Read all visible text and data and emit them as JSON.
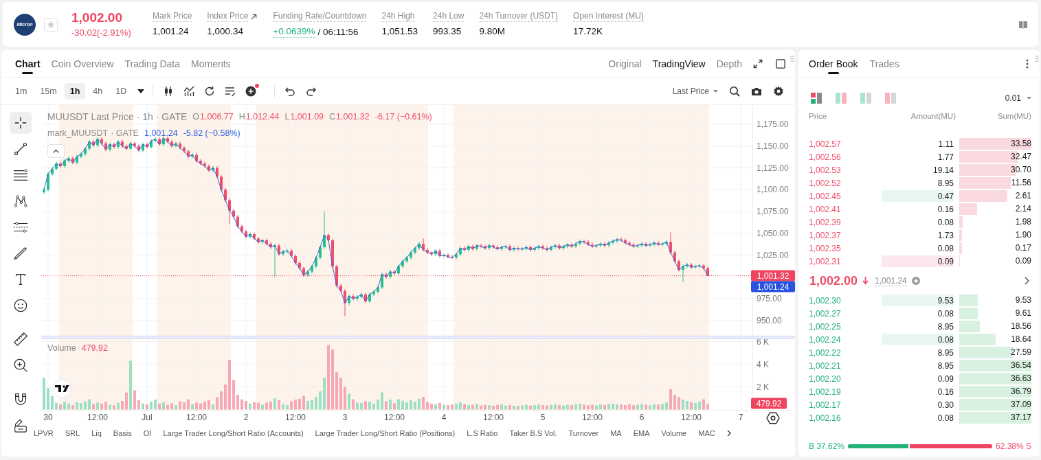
{
  "header": {
    "logo_text": "Micron",
    "starred": false,
    "price": "1,002.00",
    "change": "-30.02(-2.91%)",
    "stats": [
      {
        "kind": "plain",
        "label": "Mark Price",
        "value": "1,001.24"
      },
      {
        "kind": "link",
        "label": "Index Price",
        "value": "1,000.34"
      },
      {
        "kind": "funding",
        "label": "Funding Rate/Countdown",
        "value": "+0.0639%",
        "countdown": "/ 06:11:56"
      },
      {
        "kind": "plain",
        "label": "24h High",
        "value": "1,051.53"
      },
      {
        "kind": "plain",
        "label": "24h Low",
        "value": "993.35"
      },
      {
        "kind": "plain",
        "label": "24h Turnover (USDT)",
        "value": "9.80M"
      },
      {
        "kind": "plain",
        "label": "Open Interest (MU)",
        "value": "17.72K"
      }
    ]
  },
  "chart_panel": {
    "tabs": [
      {
        "label": "Chart",
        "selected": true
      },
      {
        "label": "Coin Overview",
        "selected": false
      },
      {
        "label": "Trading Data",
        "selected": false
      },
      {
        "label": "Moments",
        "selected": false
      }
    ],
    "views": [
      {
        "label": "Original",
        "selected": false
      },
      {
        "label": "TradingView",
        "selected": true
      },
      {
        "label": "Depth",
        "selected": false
      }
    ],
    "intervals": [
      {
        "label": "1m",
        "selected": false
      },
      {
        "label": "15m",
        "selected": false
      },
      {
        "label": "1h",
        "selected": true
      },
      {
        "label": "4h",
        "selected": false
      },
      {
        "label": "1D",
        "selected": false
      }
    ],
    "toolbar_alert": true,
    "price_source": "Last Price",
    "drawing_tools": [
      {
        "selected": true
      },
      {
        "selected": false
      },
      {
        "selected": false
      },
      {
        "selected": false
      },
      {
        "selected": false
      },
      {
        "selected": false
      },
      {
        "selected": false
      },
      {
        "selected": false
      },
      {
        "selected": false
      },
      {
        "selected": false
      },
      {
        "selected": false
      },
      {
        "selected": false
      }
    ],
    "legend": {
      "title": "MUUSDT Last Price · 1h · GATE",
      "ohlc": [
        {
          "key": "O",
          "value": "1,006.77"
        },
        {
          "key": "H",
          "value": "1,012.44"
        },
        {
          "key": "L",
          "value": "1,001.09"
        },
        {
          "key": "C",
          "value": "1,001.32"
        }
      ],
      "change": "-6.17 (−0.61%)"
    },
    "mark_legend": {
      "source": "· GATE",
      "value": "1,001.24",
      "change": "-5.82 (−0.58%)"
    },
    "chart_data": {
      "type": "candlestick",
      "grid": true,
      "ylim": [
        932.5,
        1197.05
      ],
      "yticks": [
        {
          "value": 1175,
          "label": "1,175.00"
        },
        {
          "value": 1150,
          "label": "1,150.00"
        },
        {
          "value": 1125,
          "label": "1,125.00"
        },
        {
          "value": 1100,
          "label": "1,100.00"
        },
        {
          "value": 1075,
          "label": "1,075.00"
        },
        {
          "value": 1050,
          "label": "1,050.00"
        },
        {
          "value": 1025,
          "label": "1,025.00"
        },
        {
          "value": 975,
          "label": "975.00"
        },
        {
          "value": 950,
          "label": "950.00"
        }
      ],
      "categories": [
        null,
        null,
        null,
        null,
        null,
        null,
        null,
        null,
        null,
        null,
        null,
        null,
        null,
        null,
        null,
        null,
        null,
        null,
        null,
        null,
        null,
        null,
        null,
        null,
        null,
        null,
        null,
        null,
        null,
        null,
        null,
        null,
        null,
        null,
        null,
        null,
        null,
        null,
        null,
        null,
        null,
        null,
        null,
        null,
        null,
        null,
        null,
        null,
        null,
        null,
        null,
        null,
        null,
        null,
        null,
        null,
        null,
        null,
        null,
        null,
        null,
        null,
        null,
        null,
        null,
        null,
        null,
        null,
        null,
        null,
        null,
        null,
        null,
        null,
        null,
        null,
        null,
        null,
        null,
        null,
        null,
        null,
        null,
        null,
        null,
        null,
        null,
        null,
        null,
        null,
        null,
        null,
        null,
        null,
        null,
        null,
        null,
        null,
        null,
        null,
        null,
        null,
        null,
        null,
        null,
        null,
        null,
        null,
        null,
        null,
        null,
        null,
        null,
        null,
        null,
        null,
        null,
        null,
        null,
        null,
        null,
        null,
        null,
        null,
        null,
        null,
        null,
        null,
        null,
        null,
        null,
        null,
        null,
        null,
        null,
        null,
        null,
        null,
        null,
        null,
        null,
        null,
        null,
        null,
        null,
        null,
        null,
        null,
        null,
        null,
        null,
        null,
        null,
        null,
        null,
        null,
        null,
        null,
        null,
        null,
        null,
        null,
        null,
        null,
        null,
        null,
        null,
        null,
        null,
        null,
        null
      ],
      "ohlc": [
        [
          1097,
          1102,
          1095,
          1100
        ],
        [
          1100,
          1120,
          1098,
          1118
        ],
        [
          1118,
          1126,
          1116,
          1124
        ],
        [
          1124,
          1132,
          1122,
          1130
        ],
        [
          1130,
          1132,
          1125,
          1127
        ],
        [
          1127,
          1135,
          1125,
          1133
        ],
        [
          1133,
          1138,
          1131,
          1136
        ],
        [
          1136,
          1138,
          1129,
          1131
        ],
        [
          1131,
          1140,
          1129,
          1138
        ],
        [
          1138,
          1143,
          1136,
          1141
        ],
        [
          1141,
          1149,
          1139,
          1147
        ],
        [
          1147,
          1157,
          1145,
          1155
        ],
        [
          1155,
          1157,
          1149,
          1151
        ],
        [
          1151,
          1160,
          1149,
          1158
        ],
        [
          1158,
          1160,
          1151,
          1153
        ],
        [
          1153,
          1155,
          1144,
          1146
        ],
        [
          1146,
          1154,
          1144,
          1152
        ],
        [
          1152,
          1154,
          1147,
          1149
        ],
        [
          1149,
          1157,
          1147,
          1155
        ],
        [
          1155,
          1157,
          1148,
          1150
        ],
        [
          1150,
          1152,
          1145,
          1147
        ],
        [
          1147,
          1155,
          1145,
          1153
        ],
        [
          1153,
          1155,
          1148,
          1150
        ],
        [
          1150,
          1152,
          1143,
          1145
        ],
        [
          1145,
          1154,
          1143,
          1152
        ],
        [
          1152,
          1154,
          1147,
          1149
        ],
        [
          1149,
          1158,
          1147,
          1156
        ],
        [
          1156,
          1160,
          1154,
          1158
        ],
        [
          1158,
          1160,
          1150,
          1152
        ],
        [
          1152,
          1161,
          1150,
          1159
        ],
        [
          1159,
          1161,
          1153,
          1155
        ],
        [
          1155,
          1157,
          1148,
          1150
        ],
        [
          1150,
          1155,
          1148,
          1153
        ],
        [
          1153,
          1155,
          1146,
          1148
        ],
        [
          1148,
          1150,
          1142,
          1144
        ],
        [
          1144,
          1146,
          1136,
          1138
        ],
        [
          1138,
          1142,
          1136,
          1140
        ],
        [
          1140,
          1142,
          1131,
          1133
        ],
        [
          1133,
          1135,
          1128,
          1130
        ],
        [
          1130,
          1132,
          1125,
          1127
        ],
        [
          1127,
          1129,
          1120,
          1122
        ],
        [
          1122,
          1127,
          1120,
          1125
        ],
        [
          1125,
          1127,
          1113,
          1115
        ],
        [
          1115,
          1117,
          1098,
          1100
        ],
        [
          1100,
          1102,
          1086,
          1088
        ],
        [
          1088,
          1090,
          1060,
          1076
        ],
        [
          1076,
          1078,
          1067,
          1069
        ],
        [
          1069,
          1071,
          1056,
          1058
        ],
        [
          1058,
          1060,
          1050,
          1052
        ],
        [
          1052,
          1054,
          1044,
          1046
        ],
        [
          1046,
          1051,
          1044,
          1049
        ],
        [
          1049,
          1051,
          1042,
          1044
        ],
        [
          1044,
          1046,
          1038,
          1040
        ],
        [
          1040,
          1044,
          1038,
          1042
        ],
        [
          1042,
          1044,
          1036,
          1038
        ],
        [
          1038,
          1040,
          1032,
          1034
        ],
        [
          1034,
          1038,
          1000,
          1036
        ],
        [
          1036,
          1038,
          1024,
          1026
        ],
        [
          1026,
          1031,
          1024,
          1029
        ],
        [
          1029,
          1032,
          1027,
          1030
        ],
        [
          1030,
          1032,
          1022,
          1024
        ],
        [
          1024,
          1026,
          1014,
          1016
        ],
        [
          1016,
          1018,
          1008,
          1010
        ],
        [
          1010,
          1012,
          1000,
          1002
        ],
        [
          1002,
          1008,
          1000,
          1006
        ],
        [
          1006,
          1014,
          1004,
          1012
        ],
        [
          1012,
          1024,
          1010,
          1022
        ],
        [
          1022,
          1036,
          1020,
          1034
        ],
        [
          1034,
          1075,
          1032,
          1048
        ],
        [
          1048,
          1050,
          1040,
          1042
        ],
        [
          1042,
          1044,
          1010,
          1012
        ],
        [
          1012,
          1014,
          988,
          990
        ],
        [
          990,
          992,
          982,
          984
        ],
        [
          984,
          986,
          955,
          970
        ],
        [
          970,
          980,
          968,
          978
        ],
        [
          978,
          980,
          973,
          975
        ],
        [
          975,
          979,
          973,
          977
        ],
        [
          977,
          982,
          975,
          980
        ],
        [
          980,
          982,
          970,
          972
        ],
        [
          972,
          982,
          970,
          980
        ],
        [
          980,
          985,
          978,
          983
        ],
        [
          983,
          990,
          981,
          988
        ],
        [
          988,
          1005,
          986,
          1003
        ],
        [
          1003,
          1005,
          998,
          1000
        ],
        [
          1000,
          1008,
          998,
          1006
        ],
        [
          1006,
          1008,
          1002,
          1004
        ],
        [
          1004,
          1014,
          1002,
          1012
        ],
        [
          1012,
          1020,
          1010,
          1018
        ],
        [
          1018,
          1024,
          1016,
          1022
        ],
        [
          1022,
          1030,
          1020,
          1028
        ],
        [
          1028,
          1035,
          1026,
          1033
        ],
        [
          1033,
          1040,
          1031,
          1038
        ],
        [
          1038,
          1044,
          1029,
          1031
        ],
        [
          1031,
          1033,
          1026,
          1028
        ],
        [
          1028,
          1030,
          1024,
          1026
        ],
        [
          1026,
          1032,
          1024,
          1030
        ],
        [
          1030,
          1032,
          1022,
          1024
        ],
        [
          1024,
          1027,
          1022,
          1025
        ],
        [
          1025,
          1027,
          1021,
          1023
        ],
        [
          1023,
          1025,
          1020,
          1022
        ],
        [
          1022,
          1028,
          1020,
          1026
        ],
        [
          1026,
          1035,
          1024,
          1033
        ],
        [
          1033,
          1035,
          1029,
          1031
        ],
        [
          1031,
          1037,
          1029,
          1035
        ],
        [
          1035,
          1037,
          1030,
          1032
        ],
        [
          1032,
          1038,
          1030,
          1036
        ],
        [
          1036,
          1038,
          1033,
          1035
        ],
        [
          1035,
          1037,
          1031,
          1033
        ],
        [
          1033,
          1038,
          1031,
          1036
        ],
        [
          1036,
          1038,
          1032,
          1034
        ],
        [
          1034,
          1036,
          1030,
          1032
        ],
        [
          1032,
          1036,
          1030,
          1034
        ],
        [
          1034,
          1037,
          1032,
          1035
        ],
        [
          1035,
          1037,
          1029,
          1031
        ],
        [
          1031,
          1035,
          1029,
          1033
        ],
        [
          1033,
          1035,
          1030,
          1032
        ],
        [
          1032,
          1034,
          1030,
          1032
        ],
        [
          1032,
          1036,
          1030,
          1034
        ],
        [
          1034,
          1036,
          1029,
          1031
        ],
        [
          1031,
          1035,
          1029,
          1033
        ],
        [
          1033,
          1037,
          1031,
          1035
        ],
        [
          1035,
          1037,
          1031,
          1033
        ],
        [
          1033,
          1035,
          1029,
          1031
        ],
        [
          1031,
          1036,
          1029,
          1034
        ],
        [
          1034,
          1038,
          1032,
          1036
        ],
        [
          1036,
          1038,
          1031,
          1033
        ],
        [
          1033,
          1037,
          1031,
          1035
        ],
        [
          1035,
          1039,
          1033,
          1037
        ],
        [
          1037,
          1039,
          1033,
          1035
        ],
        [
          1035,
          1040,
          1033,
          1038
        ],
        [
          1038,
          1043,
          1036,
          1041
        ],
        [
          1041,
          1043,
          1038,
          1040
        ],
        [
          1040,
          1042,
          1035,
          1037
        ],
        [
          1037,
          1039,
          1033,
          1035
        ],
        [
          1035,
          1038,
          1033,
          1036
        ],
        [
          1036,
          1040,
          1034,
          1038
        ],
        [
          1038,
          1040,
          1034,
          1036
        ],
        [
          1036,
          1041,
          1034,
          1039
        ],
        [
          1039,
          1043,
          1037,
          1041
        ],
        [
          1041,
          1045,
          1039,
          1043
        ],
        [
          1043,
          1045,
          1040,
          1042
        ],
        [
          1042,
          1044,
          1037,
          1039
        ],
        [
          1039,
          1041,
          1035,
          1037
        ],
        [
          1037,
          1039,
          1033,
          1035
        ],
        [
          1035,
          1038,
          1033,
          1036
        ],
        [
          1036,
          1040,
          1034,
          1038
        ],
        [
          1038,
          1040,
          1034,
          1036
        ],
        [
          1036,
          1039,
          1034,
          1037
        ],
        [
          1037,
          1041,
          1035,
          1039
        ],
        [
          1039,
          1041,
          1035,
          1037
        ],
        [
          1037,
          1040,
          1035,
          1038
        ],
        [
          1038,
          1042,
          1036,
          1040
        ],
        [
          1040,
          1051,
          1026,
          1028
        ],
        [
          1028,
          1030,
          1016,
          1018
        ],
        [
          1018,
          1020,
          1006,
          1008
        ],
        [
          1008,
          1014,
          994,
          1012
        ],
        [
          1012,
          1016,
          1010,
          1014
        ],
        [
          1014,
          1016,
          1009,
          1011
        ],
        [
          1011,
          1014,
          1009,
          1012
        ],
        [
          1012,
          1015,
          1010,
          1013
        ],
        [
          1013,
          1015,
          1008,
          1010
        ],
        [
          1010,
          1012,
          1001,
          1001
        ],
        null,
        null,
        null,
        null,
        null,
        null,
        null,
        null,
        null
      ],
      "series": [
        {
          "name": "mark_MUUSDT",
          "type": "line",
          "color": "#3a5fe0",
          "values": [
            1100,
            1118,
            1124,
            1130,
            1127,
            1133,
            1136,
            1131,
            1138,
            1141,
            1147,
            1155,
            1151,
            1158,
            1153,
            1146,
            1152,
            1149,
            1155,
            1150,
            1147,
            1153,
            1150,
            1145,
            1152,
            1149,
            1156,
            1158,
            1152,
            1159,
            1155,
            1150,
            1153,
            1148,
            1144,
            1138,
            1140,
            1133,
            1130,
            1127,
            1122,
            1125,
            1115,
            1100,
            1088,
            1076,
            1069,
            1058,
            1052,
            1046,
            1049,
            1044,
            1040,
            1042,
            1038,
            1034,
            1036,
            1026,
            1029,
            1030,
            1024,
            1016,
            1010,
            1002,
            1006,
            1012,
            1022,
            1034,
            1048,
            1042,
            1012,
            990,
            984,
            970,
            978,
            975,
            977,
            980,
            972,
            980,
            983,
            988,
            1003,
            1000,
            1006,
            1004,
            1012,
            1018,
            1022,
            1028,
            1033,
            1038,
            1031,
            1028,
            1026,
            1030,
            1024,
            1025,
            1023,
            1022,
            1026,
            1033,
            1031,
            1035,
            1032,
            1036,
            1035,
            1033,
            1036,
            1034,
            1032,
            1034,
            1035,
            1031,
            1033,
            1032,
            1032,
            1034,
            1031,
            1033,
            1035,
            1033,
            1031,
            1034,
            1036,
            1033,
            1035,
            1037,
            1035,
            1038,
            1041,
            1040,
            1037,
            1035,
            1036,
            1038,
            1036,
            1039,
            1041,
            1043,
            1042,
            1039,
            1037,
            1035,
            1036,
            1038,
            1036,
            1037,
            1039,
            1037,
            1038,
            1040,
            1028,
            1018,
            1008,
            1012,
            1014,
            1011,
            1012,
            1013,
            1010,
            1001,
            null,
            null,
            null,
            null,
            null,
            null,
            null,
            null,
            null
          ]
        }
      ],
      "ref_lines": [
        {
          "axis": "y",
          "value": 1001.32,
          "label": "1,001.32"
        }
      ]
    },
    "mark_price_tag": "1,001.24",
    "volume_pane": {
      "label": "Volume",
      "value": "479.92",
      "tag": "479.92",
      "chart_data": {
        "type": "bar",
        "stacked": true,
        "grid": true,
        "ylim": [
          0,
          6212
        ],
        "yticks": [
          {
            "value": 6000,
            "label": "6 K"
          },
          {
            "value": 4000,
            "label": "4 K"
          },
          {
            "value": 2000,
            "label": "2 K"
          }
        ],
        "categories": [
          null,
          "30",
          null,
          null,
          null,
          null,
          null,
          null,
          null,
          null,
          null,
          null,
          null,
          "12:00",
          null,
          null,
          null,
          null,
          null,
          null,
          null,
          null,
          null,
          null,
          null,
          "Jul",
          null,
          null,
          null,
          null,
          null,
          null,
          null,
          null,
          null,
          null,
          null,
          "12:00",
          null,
          null,
          null,
          null,
          null,
          null,
          null,
          null,
          null,
          null,
          null,
          "2",
          null,
          null,
          null,
          null,
          null,
          null,
          null,
          null,
          null,
          null,
          null,
          "12:00",
          null,
          null,
          null,
          null,
          null,
          null,
          null,
          null,
          null,
          null,
          null,
          "3",
          null,
          null,
          null,
          null,
          null,
          null,
          null,
          null,
          null,
          null,
          null,
          "12:00",
          null,
          null,
          null,
          null,
          null,
          null,
          null,
          null,
          null,
          null,
          null,
          "4",
          null,
          null,
          null,
          null,
          null,
          null,
          null,
          null,
          null,
          null,
          null,
          "12:00",
          null,
          null,
          null,
          null,
          null,
          null,
          null,
          null,
          null,
          null,
          null,
          "5",
          null,
          null,
          null,
          null,
          null,
          null,
          null,
          null,
          null,
          null,
          null,
          "12:00",
          null,
          null,
          null,
          null,
          null,
          null,
          null,
          null,
          null,
          null,
          null,
          "6",
          null,
          null,
          null,
          null,
          null,
          null,
          null,
          null,
          null,
          null,
          null,
          "12:00",
          null,
          null,
          null,
          null,
          null,
          null,
          null,
          null,
          null,
          null,
          null,
          "7",
          null
        ],
        "series": [
          {
            "color": "#9ddfc4",
            "values": [
              2800,
              1900,
              1200,
              600,
              null,
              700,
              520,
              null,
              640,
              560,
              720,
              900,
              null,
              610,
              null,
              null,
              420,
              null,
              580,
              null,
              null,
              4300,
              null,
              null,
              540,
              null,
              690,
              880,
              null,
              640,
              null,
              null,
              380,
              null,
              null,
              null,
              470,
              null,
              null,
              null,
              null,
              450,
              null,
              null,
              null,
              null,
              null,
              null,
              null,
              null,
              520,
              null,
              null,
              430,
              null,
              null,
              980,
              null,
              460,
              390,
              null,
              null,
              null,
              null,
              760,
              820,
              1100,
              1600,
              2800,
              null,
              null,
              null,
              null,
              null,
              1400,
              null,
              620,
              580,
              null,
              690,
              520,
              860,
              1500,
              null,
              880,
              null,
              910,
              780,
              640,
              820,
              700,
              960,
              null,
              null,
              null,
              470,
              null,
              410,
              null,
              null,
              520,
              640,
              null,
              390,
              null,
              510,
              null,
              null,
              380,
              null,
              null,
              450,
              360,
              null,
              340,
              null,
              370,
              420,
              null,
              380,
              440,
              null,
              null,
              410,
              470,
              null,
              350,
              420,
              null,
              460,
              510,
              null,
              null,
              null,
              360,
              440,
              null,
              470,
              520,
              480,
              null,
              null,
              null,
              null,
              410,
              480,
              null,
              390,
              460,
              null,
              500,
              620,
              null,
              null,
              null,
              900,
              760,
              null,
              580,
              700,
              null,
              null,
              null,
              null,
              null,
              null,
              null,
              null,
              null,
              null,
              null
            ]
          },
          {
            "color": "#f6a8b5",
            "values": [
              null,
              null,
              null,
              null,
              450,
              null,
              null,
              380,
              null,
              null,
              null,
              null,
              480,
              null,
              530,
              690,
              null,
              370,
              null,
              760,
              1500,
              null,
              1700,
              820,
              null,
              460,
              null,
              null,
              510,
              null,
              430,
              560,
              null,
              720,
              650,
              900,
              null,
              610,
              540,
              700,
              820,
              null,
              1100,
              1600,
              2200,
              4400,
              2600,
              1300,
              900,
              760,
              null,
              640,
              580,
              null,
              610,
              700,
              null,
              820,
              null,
              null,
              720,
              880,
              940,
              1200,
              null,
              null,
              null,
              null,
              null,
              5700,
              5300,
              3300,
              2800,
              2000,
              null,
              900,
              null,
              null,
              740,
              null,
              null,
              null,
              null,
              740,
              null,
              560,
              null,
              null,
              null,
              null,
              null,
              null,
              1100,
              680,
              520,
              null,
              590,
              null,
              380,
              450,
              null,
              null,
              470,
              null,
              430,
              null,
              360,
              420,
              null,
              330,
              410,
              null,
              null,
              390,
              null,
              310,
              null,
              null,
              350,
              null,
              null,
              390,
              360,
              null,
              null,
              380,
              null,
              null,
              390,
              null,
              null,
              430,
              380,
              410,
              null,
              null,
              400,
              null,
              null,
              null,
              430,
              390,
              450,
              370,
              null,
              null,
              420,
              null,
              null,
              430,
              null,
              null,
              1800,
              1300,
              1100,
              null,
              null,
              640,
              null,
              null,
              900,
              480,
              null,
              null,
              null,
              null,
              null,
              null,
              null,
              null,
              null
            ]
          }
        ]
      }
    },
    "indicators": [
      "LPVR",
      "SRL",
      "Liq",
      "Basis",
      "OI",
      "Large Trader Long/Short Ratio (Accounts)",
      "Large Trader Long/Short Ratio (Positions)",
      "L.S Ratio",
      "Taker B.S Vol.",
      "Turnover",
      "MA",
      "EMA",
      "Volume",
      "MAC"
    ]
  },
  "order_book": {
    "tabs": [
      {
        "label": "Order Book",
        "selected": true
      },
      {
        "label": "Trades",
        "selected": false
      }
    ],
    "layouts": [
      {
        "selected": true
      },
      {
        "selected": false
      },
      {
        "selected": false
      },
      {
        "selected": false
      }
    ],
    "precision": "0.01",
    "columns": [
      "Price",
      "Amount(MU)",
      "Sum(MU)"
    ],
    "asks": [
      {
        "price": "1,002.57",
        "amount": "1.11",
        "sum": "33.58",
        "level": 1.0,
        "increased": false,
        "decreased": false
      },
      {
        "price": "1,002.56",
        "amount": "1.77",
        "sum": "32.47",
        "level": 0.81,
        "increased": false,
        "decreased": false
      },
      {
        "price": "1,002.53",
        "amount": "19.14",
        "sum": "30.70",
        "level": 0.78,
        "increased": false,
        "decreased": false
      },
      {
        "price": "1,002.52",
        "amount": "8.95",
        "sum": "11.56",
        "level": 0.71,
        "increased": false,
        "decreased": false
      },
      {
        "price": "1,002.45",
        "amount": "0.47",
        "sum": "2.61",
        "level": 0.67,
        "increased": true,
        "decreased": false
      },
      {
        "price": "1,002.41",
        "amount": "0.16",
        "sum": "2.14",
        "level": 0.25,
        "increased": false,
        "decreased": false
      },
      {
        "price": "1,002.39",
        "amount": "0.08",
        "sum": "1.98",
        "level": 0.05,
        "increased": false,
        "decreased": false
      },
      {
        "price": "1,002.37",
        "amount": "1.73",
        "sum": "1.90",
        "level": 0.04,
        "increased": false,
        "decreased": false
      },
      {
        "price": "1,002.35",
        "amount": "0.08",
        "sum": "0.17",
        "level": 0.04,
        "increased": false,
        "decreased": false
      },
      {
        "price": "1,002.31",
        "amount": "0.09",
        "sum": "0.09",
        "level": 0.0,
        "increased": false,
        "decreased": true
      }
    ],
    "last_price": "1,002.00",
    "falling": true,
    "mark_price": "1,001.24",
    "bids": [
      {
        "price": "1,002.30",
        "amount": "9.53",
        "sum": "9.53",
        "level": 0.26,
        "increased": true,
        "decreased": false
      },
      {
        "price": "1,002.27",
        "amount": "0.08",
        "sum": "9.61",
        "level": 0.26,
        "increased": false,
        "decreased": false
      },
      {
        "price": "1,002.25",
        "amount": "8.95",
        "sum": "18.56",
        "level": 0.29,
        "increased": false,
        "decreased": false
      },
      {
        "price": "1,002.24",
        "amount": "0.08",
        "sum": "18.64",
        "level": 0.5,
        "increased": true,
        "decreased": false
      },
      {
        "price": "1,002.22",
        "amount": "8.95",
        "sum": "27.59",
        "level": 0.74,
        "increased": false,
        "decreased": false
      },
      {
        "price": "1,002.21",
        "amount": "8.95",
        "sum": "36.54",
        "level": 1.0,
        "increased": false,
        "decreased": false
      },
      {
        "price": "1,002.20",
        "amount": "0.09",
        "sum": "36.63",
        "level": 1.0,
        "increased": false,
        "decreased": false
      },
      {
        "price": "1,002.19",
        "amount": "0.16",
        "sum": "36.79",
        "level": 1.0,
        "increased": false,
        "decreased": false
      },
      {
        "price": "1,002.17",
        "amount": "0.30",
        "sum": "37.09",
        "level": 1.0,
        "increased": false,
        "decreased": false
      },
      {
        "price": "1,002.16",
        "amount": "0.08",
        "sum": "37.17",
        "level": 1.0,
        "increased": false,
        "decreased": false
      }
    ],
    "ratio": {
      "buy": "B 37.62%",
      "sell": "62.38% S",
      "level": 0.42
    }
  }
}
